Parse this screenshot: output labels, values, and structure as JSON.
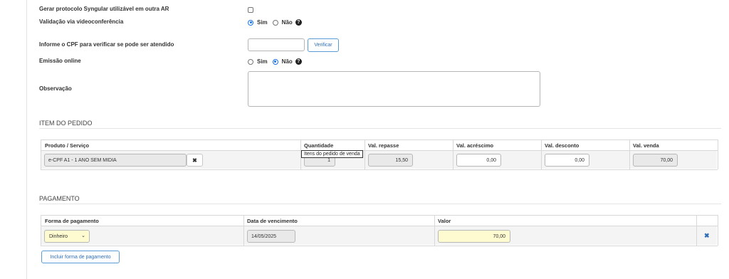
{
  "form": {
    "syngular_label": "Gerar protocolo Syngular utilizável em outra AR",
    "video_label": "Validação via videoconferência",
    "video_yes": "Sim",
    "video_no": "Não",
    "cpf_label": "Informe o CPF para verificar se pode ser atendido",
    "cpf_value": "",
    "verify_button": "Verificar",
    "online_label": "Emissão online",
    "online_yes": "Sim",
    "online_no": "Não",
    "obs_label": "Observação",
    "obs_value": "",
    "help_glyph": "?"
  },
  "item": {
    "title": "ITEM DO PEDIDO",
    "headers": [
      "Produto / Serviço",
      "Quantidade",
      "Val. repasse",
      "Val. acréscimo",
      "Val. desconto",
      "Val. venda"
    ],
    "row": {
      "product": "e-CPF A1 - 1 ANO SEM MIDIA",
      "quantity": "1",
      "repasse": "15,50",
      "acrescimo": "0,00",
      "desconto": "0,00",
      "venda": "70,00"
    },
    "tooltip": "Itens do pedido de venda",
    "remove_glyph": "✖"
  },
  "payment": {
    "title": "PAGAMENTO",
    "headers": [
      "Forma de pagamento",
      "Data de vencimento",
      "Valor"
    ],
    "row": {
      "method": "Dinheiro",
      "due_date": "14/05/2025",
      "value": "70,00"
    },
    "add_button": "Incluir forma de pagamento",
    "remove_glyph": "✖"
  },
  "colors": {
    "accent": "#1a73e8",
    "button_border": "#5b9bd5",
    "highlight": "#fffbd0"
  }
}
